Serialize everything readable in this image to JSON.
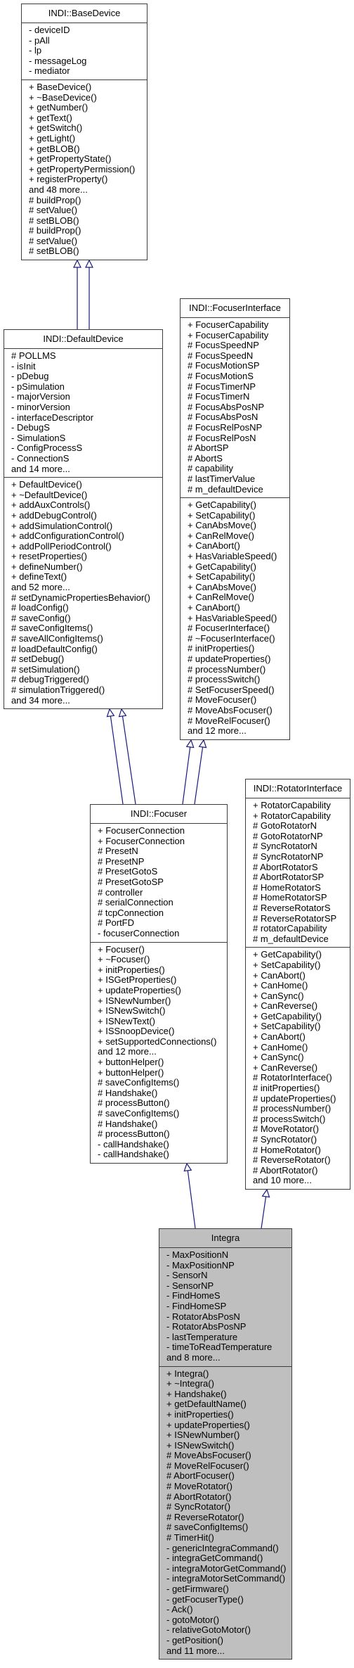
{
  "diagram": {
    "type": "inheritance",
    "edge_color": "#1a1a7f",
    "current_class_fill": "#bfbfbf",
    "classes": {
      "base_device": {
        "name": "INDI::BaseDevice",
        "attributes": [
          "- deviceID",
          "- pAll",
          "- lp",
          "- messageLog",
          "- mediator"
        ],
        "methods": [
          "+ BaseDevice()",
          "+ ~BaseDevice()",
          "+ getNumber()",
          "+ getText()",
          "+ getSwitch()",
          "+ getLight()",
          "+ getBLOB()",
          "+ getPropertyState()",
          "+ getPropertyPermission()",
          "+ registerProperty()",
          "and 48 more...",
          "# buildProp()",
          "# setValue()",
          "# setBLOB()",
          "# buildProp()",
          "# setValue()",
          "# setBLOB()"
        ]
      },
      "default_device": {
        "name": "INDI::DefaultDevice",
        "attributes": [
          "# POLLMS",
          "- isInit",
          "- pDebug",
          "- pSimulation",
          "- majorVersion",
          "- minorVersion",
          "- interfaceDescriptor",
          "- DebugS",
          "- SimulationS",
          "- ConfigProcessS",
          "- ConnectionS",
          "and 14 more..."
        ],
        "methods": [
          "+ DefaultDevice()",
          "+ ~DefaultDevice()",
          "+ addAuxControls()",
          "+ addDebugControl()",
          "+ addSimulationControl()",
          "+ addConfigurationControl()",
          "+ addPollPeriodControl()",
          "+ resetProperties()",
          "+ defineNumber()",
          "+ defineText()",
          "and 52 more...",
          "# setDynamicPropertiesBehavior()",
          "# loadConfig()",
          "# saveConfig()",
          "# saveConfigItems()",
          "# saveAllConfigItems()",
          "# loadDefaultConfig()",
          "# setDebug()",
          "# setSimulation()",
          "# debugTriggered()",
          "# simulationTriggered()",
          "and 34 more..."
        ]
      },
      "focuser_interface": {
        "name": "INDI::FocuserInterface",
        "attributes": [
          "+ FocuserCapability",
          "+ FocuserCapability",
          "# FocusSpeedNP",
          "# FocusSpeedN",
          "# FocusMotionSP",
          "# FocusMotionS",
          "# FocusTimerNP",
          "# FocusTimerN",
          "# FocusAbsPosNP",
          "# FocusAbsPosN",
          "# FocusRelPosNP",
          "# FocusRelPosN",
          "# AbortSP",
          "# AbortS",
          "# capability",
          "# lastTimerValue",
          "# m_defaultDevice"
        ],
        "methods": [
          "+ GetCapability()",
          "+ SetCapability()",
          "+ CanAbsMove()",
          "+ CanRelMove()",
          "+ CanAbort()",
          "+ HasVariableSpeed()",
          "+ GetCapability()",
          "+ SetCapability()",
          "+ CanAbsMove()",
          "+ CanRelMove()",
          "+ CanAbort()",
          "+ HasVariableSpeed()",
          "# FocuserInterface()",
          "# ~FocuserInterface()",
          "# initProperties()",
          "# updateProperties()",
          "# processNumber()",
          "# processSwitch()",
          "# SetFocuserSpeed()",
          "# MoveFocuser()",
          "# MoveAbsFocuser()",
          "# MoveRelFocuser()",
          "and 12 more..."
        ]
      },
      "focuser": {
        "name": "INDI::Focuser",
        "attributes": [
          "+ FocuserConnection",
          "+ FocuserConnection",
          "# PresetN",
          "# PresetNP",
          "# PresetGotoS",
          "# PresetGotoSP",
          "# controller",
          "# serialConnection",
          "# tcpConnection",
          "# PortFD",
          "- focuserConnection"
        ],
        "methods": [
          "+ Focuser()",
          "+ ~Focuser()",
          "+ initProperties()",
          "+ ISGetProperties()",
          "+ updateProperties()",
          "+ ISNewNumber()",
          "+ ISNewSwitch()",
          "+ ISNewText()",
          "+ ISSnoopDevice()",
          "+ setSupportedConnections()",
          "and 12 more...",
          "+ buttonHelper()",
          "+ buttonHelper()",
          "# saveConfigItems()",
          "# Handshake()",
          "# processButton()",
          "# saveConfigItems()",
          "# Handshake()",
          "# processButton()",
          "- callHandshake()",
          "- callHandshake()"
        ]
      },
      "rotator_interface": {
        "name": "INDI::RotatorInterface",
        "attributes": [
          "+ RotatorCapability",
          "+ RotatorCapability",
          "# GotoRotatorN",
          "# GotoRotatorNP",
          "# SyncRotatorN",
          "# SyncRotatorNP",
          "# AbortRotatorS",
          "# AbortRotatorSP",
          "# HomeRotatorS",
          "# HomeRotatorSP",
          "# ReverseRotatorS",
          "# ReverseRotatorSP",
          "# rotatorCapability",
          "# m_defaultDevice"
        ],
        "methods": [
          "+ GetCapability()",
          "+ SetCapability()",
          "+ CanAbort()",
          "+ CanHome()",
          "+ CanSync()",
          "+ CanReverse()",
          "+ GetCapability()",
          "+ SetCapability()",
          "+ CanAbort()",
          "+ CanHome()",
          "+ CanSync()",
          "+ CanReverse()",
          "# RotatorInterface()",
          "# initProperties()",
          "# updateProperties()",
          "# processNumber()",
          "# processSwitch()",
          "# MoveRotator()",
          "# SyncRotator()",
          "# HomeRotator()",
          "# ReverseRotator()",
          "# AbortRotator()",
          "and 10 more..."
        ]
      },
      "integra": {
        "name": "Integra",
        "attributes": [
          "- MaxPositionN",
          "- MaxPositionNP",
          "- SensorN",
          "- SensorNP",
          "- FindHomeS",
          "- FindHomeSP",
          "- RotatorAbsPosN",
          "- RotatorAbsPosNP",
          "- lastTemperature",
          "- timeToReadTemperature",
          "and 8 more..."
        ],
        "methods": [
          "+ Integra()",
          "+ ~Integra()",
          "+ Handshake()",
          "+ getDefaultName()",
          "+ initProperties()",
          "+ updateProperties()",
          "+ ISNewNumber()",
          "+ ISNewSwitch()",
          "# MoveAbsFocuser()",
          "# MoveRelFocuser()",
          "# AbortFocuser()",
          "# MoveRotator()",
          "# AbortRotator()",
          "# SyncRotator()",
          "# ReverseRotator()",
          "# saveConfigItems()",
          "# TimerHit()",
          "- genericIntegraCommand()",
          "- integraGetCommand()",
          "- integraMotorGetCommand()",
          "- integraMotorSetCommand()",
          "- getFirmware()",
          "- getFocuserType()",
          "- Ack()",
          "- gotoMotor()",
          "- relativeGotoMotor()",
          "- getPosition()",
          "and 11 more..."
        ]
      }
    },
    "inheritance": [
      {
        "child": "INDI::DefaultDevice",
        "parent": "INDI::BaseDevice",
        "count": 2
      },
      {
        "child": "INDI::Focuser",
        "parent": "INDI::DefaultDevice",
        "count": 2
      },
      {
        "child": "INDI::Focuser",
        "parent": "INDI::FocuserInterface",
        "count": 2
      },
      {
        "child": "Integra",
        "parent": "INDI::Focuser",
        "count": 1
      },
      {
        "child": "Integra",
        "parent": "INDI::RotatorInterface",
        "count": 1
      }
    ]
  }
}
